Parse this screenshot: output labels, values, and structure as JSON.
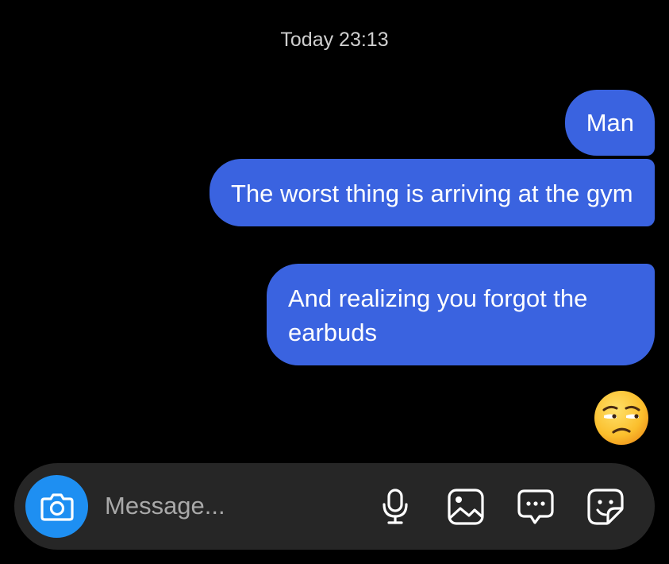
{
  "header": {
    "timestamp": "Today 23:13"
  },
  "messages": [
    {
      "sender": "me",
      "text": "Man"
    },
    {
      "sender": "me",
      "text": "The worst thing is arriving at the gym"
    },
    {
      "sender": "me",
      "text": "And realizing you forgot the earbuds"
    },
    {
      "sender": "me",
      "emoji": "unamused-face-icon"
    }
  ],
  "composer": {
    "placeholder": "Message...",
    "value": "",
    "icons": [
      "camera-icon",
      "microphone-icon",
      "gallery-icon",
      "chat-bubble-icon",
      "sticker-icon"
    ]
  },
  "colors": {
    "background": "#000000",
    "bubble": "#3a63e0",
    "composer": "#262626",
    "camera_button": "#1e8ff2"
  }
}
